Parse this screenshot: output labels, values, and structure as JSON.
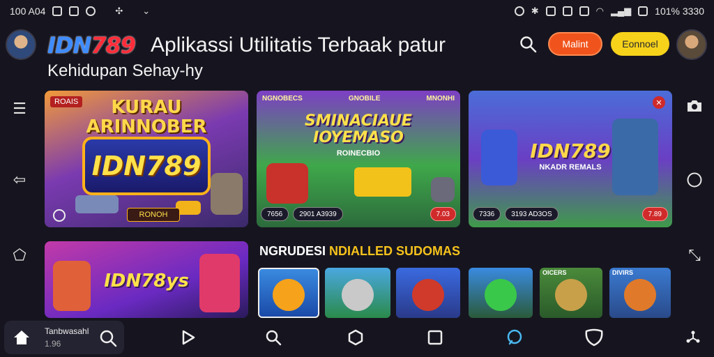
{
  "status_bar": {
    "time": "100 A04",
    "right_text": "101% 3330"
  },
  "header": {
    "logo_a": "IDN",
    "logo_b": "789",
    "title_line1": "Aplikassi Utilitatis Terbaak patur",
    "title_line2": "Kehidupan Sehay-hy",
    "btn_red": "Malint",
    "btn_yellow": "Eonnoel"
  },
  "cards": {
    "card1": {
      "tag": "ROAIS",
      "title1": "KURAU",
      "title2": "ARINNOBER",
      "logo": "IDN789",
      "button": "RONOH"
    },
    "card2": {
      "tabs": [
        "NGNOBECS",
        "GNOBILE",
        "MNONHI"
      ],
      "title1": "SMINACIAUE",
      "title2": "IOYEMASO",
      "subtitle": "ROINECBIO",
      "stats": [
        "7656",
        "2901 A3939",
        "7.03"
      ]
    },
    "card3": {
      "logo": "IDN789",
      "subtitle": "NKADR REMALS",
      "stats": [
        "7336",
        "3193 AD3OS",
        "7.89"
      ]
    },
    "card4": {
      "logo": "IDN78ys"
    }
  },
  "section": {
    "title_white": "NGRUDESI",
    "title_yellow": "NDIALLED SUDOMAS"
  },
  "thumbs": [
    {
      "label": "",
      "accent": "#f6a21b"
    },
    {
      "label": "",
      "accent": "#c9c9c9"
    },
    {
      "label": "",
      "accent": "#d03a2a"
    },
    {
      "label": "",
      "accent": "#3ac84a"
    },
    {
      "label": "OICERS",
      "accent": "#c8a04a"
    },
    {
      "label": "DIVIRS",
      "accent": "#e07a2a"
    }
  ],
  "bottom_nav": {
    "home_label": "Tanbwasahl",
    "home_sub": "1.96"
  },
  "icons": {
    "menu": "menu-icon",
    "back": "back-arrow-icon",
    "tag": "tag-icon",
    "camera": "camera-icon",
    "circle": "circle-icon",
    "share": "share-icon",
    "search": "search-icon",
    "home": "home-icon"
  },
  "colors": {
    "accent_red": "#f0541c",
    "accent_yellow": "#f6d21b",
    "accent_blue": "#3f8cff",
    "background": "#16151f"
  }
}
